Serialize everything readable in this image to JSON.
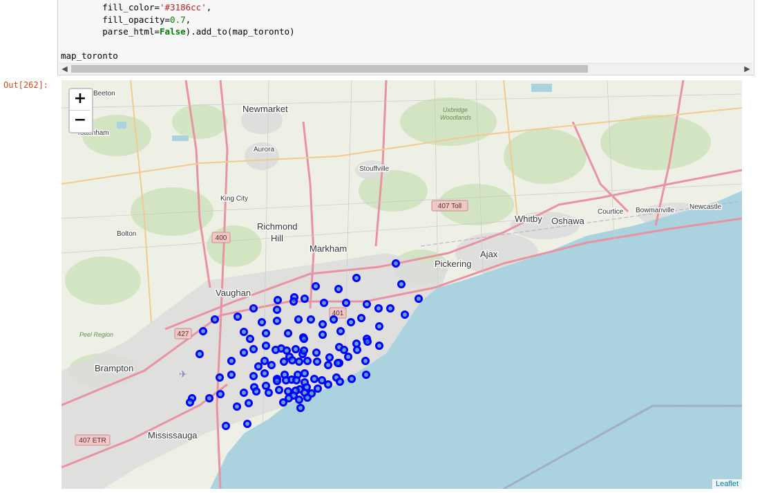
{
  "notebook": {
    "code_lines": [
      {
        "segments": [
          {
            "t": "        fill_color=",
            "c": ""
          },
          {
            "t": "'#3186cc'",
            "c": "tok-str"
          },
          {
            "t": ",",
            "c": ""
          }
        ]
      },
      {
        "segments": [
          {
            "t": "        fill_opacity=",
            "c": ""
          },
          {
            "t": "0.7",
            "c": "tok-num"
          },
          {
            "t": ",",
            "c": ""
          }
        ]
      },
      {
        "segments": [
          {
            "t": "        parse_html=",
            "c": ""
          },
          {
            "t": "False",
            "c": "tok-kw"
          },
          {
            "t": ").add_to(map_toronto)",
            "c": ""
          }
        ]
      },
      {
        "segments": [
          {
            "t": "",
            "c": ""
          }
        ]
      },
      {
        "segments": [
          {
            "t": "map_toronto",
            "c": ""
          }
        ]
      }
    ],
    "out_prompt": "Out[262]:"
  },
  "map": {
    "zoom_in_label": "+",
    "zoom_out_label": "−",
    "attribution": "Leaflet",
    "place_labels": [
      {
        "text": "Beeton",
        "size": 10
      },
      {
        "text": "Newmarket",
        "size": 13
      },
      {
        "text": "Tottenham",
        "size": 10
      },
      {
        "text": "Aurora",
        "size": 10
      },
      {
        "text": "Stouffville",
        "size": 10
      },
      {
        "text": "King City",
        "size": 10
      },
      {
        "text": "Richmond",
        "size": 13
      },
      {
        "text": "Hill",
        "size": 13
      },
      {
        "text": "Bolton",
        "size": 10
      },
      {
        "text": "Markham",
        "size": 13
      },
      {
        "text": "Pickering",
        "size": 13
      },
      {
        "text": "Ajax",
        "size": 13
      },
      {
        "text": "Whitby",
        "size": 13
      },
      {
        "text": "Oshawa",
        "size": 13
      },
      {
        "text": "Courtice",
        "size": 10
      },
      {
        "text": "Bowmanville",
        "size": 10
      },
      {
        "text": "Newcastle",
        "size": 10
      },
      {
        "text": "Vaughan",
        "size": 13
      },
      {
        "text": "Brampton",
        "size": 13
      },
      {
        "text": "Mississauga",
        "size": 13
      }
    ],
    "italic_labels": [
      "Uxbridge",
      "Woodlands",
      "Peel Region"
    ],
    "road_shields": [
      "400",
      "407 Toll",
      "401",
      "427",
      "407 ETR"
    ],
    "marker_color": "#0000ff",
    "marker_fill": "#3186cc"
  }
}
